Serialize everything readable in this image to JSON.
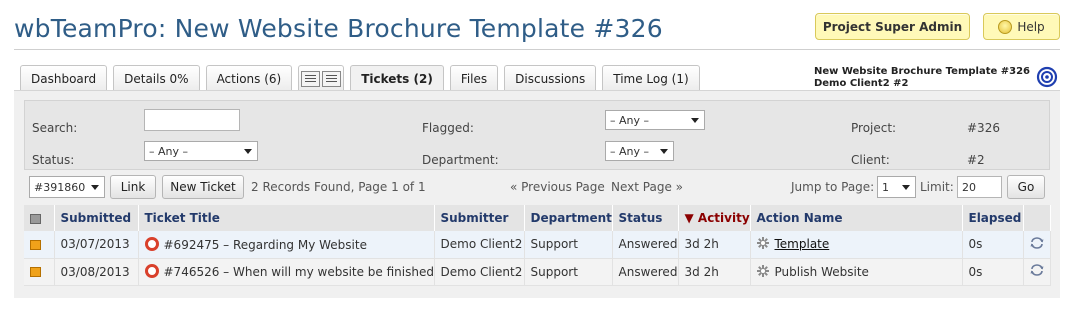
{
  "page": {
    "title": "wbTeamPro: New Website Brochure Template #326",
    "project_admin_label": "Project Super Admin",
    "help_label": "Help"
  },
  "tabs": [
    {
      "label": "Dashboard"
    },
    {
      "label": "Details 0%"
    },
    {
      "label": "Actions (6)"
    },
    {
      "label": "Tickets (2)",
      "active": true
    },
    {
      "label": "Files"
    },
    {
      "label": "Discussions"
    },
    {
      "label": "Time Log (1)"
    }
  ],
  "project_info": {
    "name": "New Website Brochure Template #326",
    "client": "Demo Client2 #2"
  },
  "filters": {
    "search_label": "Search:",
    "search_value": "",
    "status_label": "Status:",
    "status_value": "– Any –",
    "flagged_label": "Flagged:",
    "flagged_value": "– Any –",
    "department_label": "Department:",
    "department_value": "– Any –",
    "project_label": "Project:",
    "project_value": "#326",
    "client_label": "Client:",
    "client_value": "#2"
  },
  "toolbar": {
    "ticket_select": "#391860",
    "link_label": "Link",
    "new_ticket_label": "New Ticket",
    "records_text": "2 Records Found, Page 1 of 1",
    "prev_label": "« Previous Page",
    "next_label": "Next Page »",
    "jump_label": "Jump to Page:",
    "jump_value": "1",
    "limit_label": "Limit:",
    "limit_value": "20",
    "go_label": "Go"
  },
  "table": {
    "headers": {
      "submitted": "Submitted",
      "title": "Ticket Title",
      "submitter": "Submitter",
      "department": "Department",
      "status": "Status",
      "activity": "▼ Activity",
      "action": "Action Name",
      "elapsed": "Elapsed"
    },
    "rows": [
      {
        "submitted": "03/07/2013",
        "title": "#692475 – Regarding My Website",
        "submitter": "Demo Client2",
        "department": "Support",
        "status": "Answered",
        "activity": "3d 2h",
        "action": "Template",
        "elapsed": "0s"
      },
      {
        "submitted": "03/08/2013",
        "title": "#746526 – When will my website be finished",
        "submitter": "Demo Client2",
        "department": "Support",
        "status": "Answered",
        "activity": "3d 2h",
        "action": "Publish Website",
        "elapsed": "0s"
      }
    ]
  },
  "colors": {
    "title": "#2f5d87",
    "header_text": "#233a6b",
    "sorted_header": "#8b0000",
    "admin_button_bg": "#fff9b8"
  },
  "icons": [
    "flag-icon",
    "lifebuoy-icon",
    "gear-icon",
    "sync-icon",
    "bulb-icon",
    "list-view-icon",
    "detail-view-icon",
    "project-logo-icon"
  ]
}
